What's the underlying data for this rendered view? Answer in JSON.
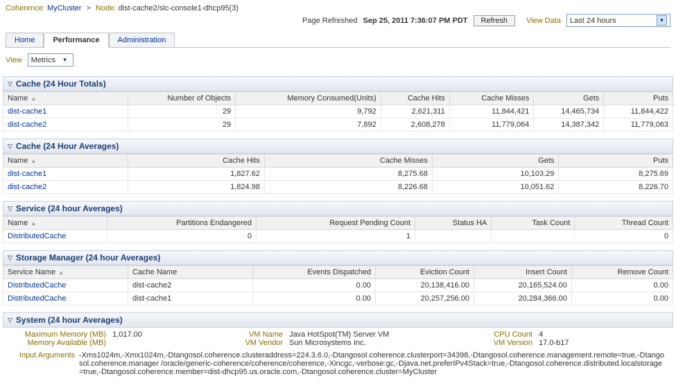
{
  "breadcrumb": {
    "coherence_label": "Coherence:",
    "cluster": "MyCluster",
    "sep": ">",
    "node_label": "Node:",
    "node": "dist-cache2/slc-console1-dhcp95(3)"
  },
  "header": {
    "page_refreshed_label": "Page Refreshed",
    "page_refreshed_time": "Sep 25, 2011 7:36:07 PM PDT",
    "refresh_btn": "Refresh",
    "view_data_label": "View Data",
    "view_data_value": "Last 24 hours"
  },
  "tabs": {
    "home": "Home",
    "performance": "Performance",
    "administration": "Administration"
  },
  "view_row": {
    "view_label": "View",
    "metrics": "Metrics"
  },
  "cache_totals": {
    "title": "Cache (24 Hour Totals)",
    "cols": {
      "name": "Name",
      "objs": "Number of Objects",
      "mem": "Memory Consumed(Units)",
      "hits": "Cache Hits",
      "misses": "Cache Misses",
      "gets": "Gets",
      "puts": "Puts"
    },
    "rows": [
      {
        "name": "dist-cache1",
        "objs": "29",
        "mem": "9,792",
        "hits": "2,621,311",
        "misses": "11,844,421",
        "gets": "14,465,734",
        "puts": "11,844,422"
      },
      {
        "name": "dist-cache2",
        "objs": "29",
        "mem": "7,892",
        "hits": "2,608,278",
        "misses": "11,779,064",
        "gets": "14,387,342",
        "puts": "11,779,063"
      }
    ]
  },
  "cache_avgs": {
    "title": "Cache (24 Hour Averages)",
    "cols": {
      "name": "Name",
      "hits": "Cache Hits",
      "misses": "Cache Misses",
      "gets": "Gets",
      "puts": "Puts"
    },
    "rows": [
      {
        "name": "dist-cache1",
        "hits": "1,827.62",
        "misses": "8,275.68",
        "gets": "10,103.29",
        "puts": "8,275.69"
      },
      {
        "name": "dist-cache2",
        "hits": "1,824.98",
        "misses": "8,226.68",
        "gets": "10,051.62",
        "puts": "8,226.70"
      }
    ]
  },
  "service_avgs": {
    "title": "Service (24 hour Averages)",
    "cols": {
      "name": "Name",
      "partitions": "Partitions Endangered",
      "pending": "Request Pending Count",
      "statusha": "Status HA",
      "task": "Task Count",
      "thread": "Thread Count"
    },
    "rows": [
      {
        "name": "DistributedCache",
        "partitions": "0",
        "pending": "1",
        "statusha": "",
        "task": "",
        "thread": "0"
      }
    ]
  },
  "storage_mgr": {
    "title": "Storage Manager (24 hour Averages)",
    "cols": {
      "svc": "Service Name",
      "cache": "Cache Name",
      "events": "Events Dispatched",
      "eviction": "Eviction Count",
      "insert": "Insert Count",
      "remove": "Remove Count"
    },
    "rows": [
      {
        "svc": "DistributedCache",
        "cache": "dist-cache2",
        "events": "0.00",
        "eviction": "20,138,416.00",
        "insert": "20,165,524.00",
        "remove": "0.00"
      },
      {
        "svc": "DistributedCache",
        "cache": "dist-cache1",
        "events": "0.00",
        "eviction": "20,257,256.00",
        "insert": "20,284,366.00",
        "remove": "0.00"
      }
    ]
  },
  "system": {
    "title": "System (24 hour Averages)",
    "max_mem_label": "Maximum Memory (MB)",
    "max_mem_val": "1,017.00",
    "mem_avail_label": "Memory Available (MB)",
    "vm_name_label": "VM Name",
    "vm_name_val": "Java HotSpot(TM) Server VM",
    "vm_vendor_label": "VM Vendor",
    "vm_vendor_val": "Sun Microsystems Inc.",
    "cpu_count_label": "CPU Count",
    "cpu_count_val": "4",
    "vm_version_label": "VM Version",
    "vm_version_val": "17.0-b17",
    "input_args_label": "Input Arguments",
    "input_args_val": "-Xms1024m,-Xmx1024m,-Dtangosol.coherence.clusteraddress=224.3.6.0,-Dtangosol.coherence.clusterport=34398,-Dtangosol.coherence.management.remote=true,-Dtangosol.coherence.manager /oracle/generic-coherence/coherence/coherence,-Xincgc,-verbose:gc,-Djava.net.preferIPv4Stack=true,-Dtangosol.coherence.distributed.localstorage=true,-Dtangosol.coherence.member=dist-dhcp95.us.oracle.com,-Dtangosol.coherence.cluster=MyCluster"
  }
}
